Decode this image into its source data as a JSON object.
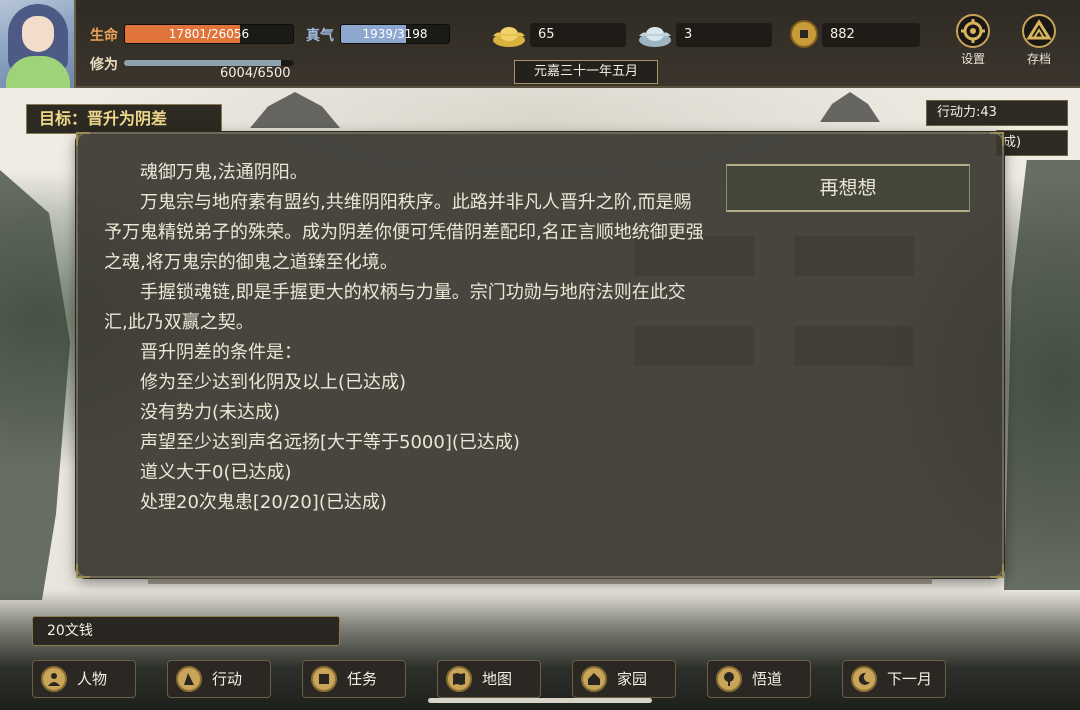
{
  "player": {
    "hp_label": "生命",
    "hp_text": "17801/26056",
    "hp_value": 17801,
    "hp_max": 26056,
    "qi_label": "真气",
    "qi_text": "1939/3198",
    "qi_value": 1939,
    "qi_max": 3198,
    "cultivation_label": "修为",
    "cultivation_text": "6004/6500",
    "cultivation_value": 6004,
    "cultivation_max": 6500
  },
  "currency": {
    "gold_value": "65",
    "silver_value": "3",
    "coin_value": "882"
  },
  "date": "元嘉三十一年五月",
  "top_buttons": {
    "settings_label": "设置",
    "save_label": "存档"
  },
  "goal": "目标：晋升为阴差",
  "action_points": "行动力:43",
  "action_points_extra": "成)",
  "dialog": {
    "paragraphs": [
      "魂御万鬼,法通阴阳。",
      "万鬼宗与地府素有盟约,共维阴阳秩序。此路并非凡人晋升之阶,而是赐予万鬼精锐弟子的殊荣。成为阴差你便可凭借阴差配印,名正言顺地统御更强之魂,将万鬼宗的御鬼之道臻至化境。",
      "手握锁魂链,即是手握更大的权柄与力量。宗门功勋与地府法则在此交汇,此乃双赢之契。",
      "晋升阴差的条件是："
    ],
    "conditions": [
      "修为至少达到化阴及以上(已达成)",
      "没有势力(未达成)",
      "声望至少达到声名远扬[大于等于5000](已达成)",
      "道义大于0(已达成)",
      "处理20次鬼患[20/20](已达成)"
    ],
    "rethink_label": "再想想"
  },
  "log_text": "20文钱",
  "nav": {
    "character": "人物",
    "action": "行动",
    "task": "任务",
    "map": "地图",
    "home": "家园",
    "enlighten": "悟道",
    "next_month": "下一月"
  },
  "colors": {
    "hp_fill": "#e0743a",
    "qi_fill": "#8ea7cf",
    "accent_gold": "#c9a55a"
  }
}
